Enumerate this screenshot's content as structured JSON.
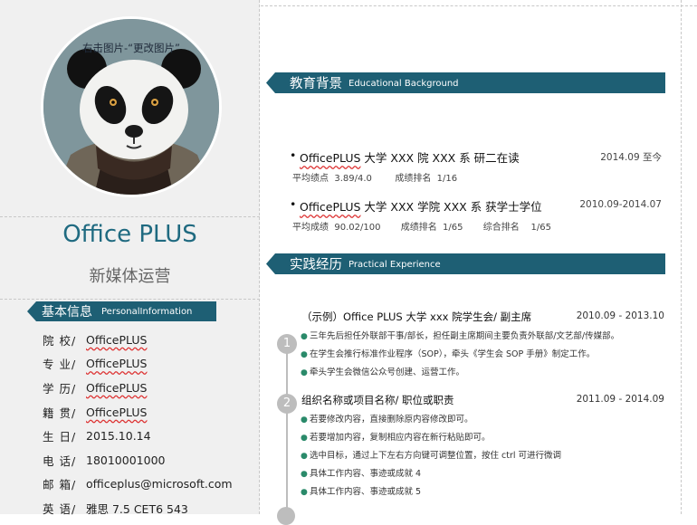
{
  "avatar": {
    "hint": "右击图片-“更改图片”"
  },
  "profile": {
    "name": "Office PLUS",
    "title": "新媒体运营"
  },
  "personal_info": {
    "heading_cn": "基本信息",
    "heading_en": "PersonalInformation",
    "rows": [
      {
        "label": "院 校/",
        "value": "OfficePLUS"
      },
      {
        "label": "专 业/",
        "value": "OfficePLUS"
      },
      {
        "label": "学 历/",
        "value": "OfficePLUS"
      },
      {
        "label": "籍 贯/",
        "value": "OfficePLUS"
      },
      {
        "label": "生 日/",
        "value": "2015.10.14"
      },
      {
        "label": "电 话/",
        "value": "18010001000"
      },
      {
        "label": "邮 箱/",
        "value": "officeplus@microsoft.com"
      },
      {
        "label": "英 语/",
        "value": "雅思  7.5    CET6 543"
      }
    ]
  },
  "education": {
    "heading_cn": "教育背景",
    "heading_en": "Educational Background",
    "items": [
      {
        "bullet": "•",
        "brand": "OfficePLUS",
        "school": " 大学  XXX 院  XXX 系  研二在读",
        "date": "2014.09  至今",
        "details": "平均绩点  3.89/4.0        成绩排名  1/16"
      },
      {
        "bullet": "•",
        "brand": "OfficePLUS",
        "school": " 大学  XXX 学院  XXX 系  获学士学位",
        "date": "2010.09-2014.07",
        "details": "平均成绩  90.02/100       成绩排名  1/65       综合排名    1/65"
      }
    ]
  },
  "experience": {
    "heading_cn": "实践经历",
    "heading_en": "Practical Experience",
    "items": [
      {
        "index": "1",
        "title": "（示例）Office PLUS 大学  xxx 院学生会/  副主席",
        "date": "2010.09 - 2013.10",
        "bullets": [
          "三年先后担任外联部干事/部长，担任副主席期间主要负责外联部/文艺部/传媒部。",
          "在学生会推行标准作业程序（SOP），牵头《学生会 SOP 手册》制定工作。",
          "牵头学生会微信公众号创建、运营工作。"
        ]
      },
      {
        "index": "2",
        "title": "组织名称或项目名称/  职位或职责",
        "date": "2011.09 - 2014.09",
        "bullets": [
          "若要修改内容，直接删除原内容修改即可。",
          "若要增加内容，复制相应内容在新行粘贴即可。",
          "选中目标，通过上下左右方向键可调整位置，按住 ctrl 可进行微调",
          "具体工作内容、事迹或成就 4",
          "具体工作内容、事迹或成就 5"
        ]
      }
    ]
  },
  "colors": {
    "accent": "#1e5f74",
    "name": "#1f6a80",
    "sidebar_bg": "#f0f0f0",
    "timeline": "#bdbdbd",
    "bullet": "#2a8a6a"
  }
}
